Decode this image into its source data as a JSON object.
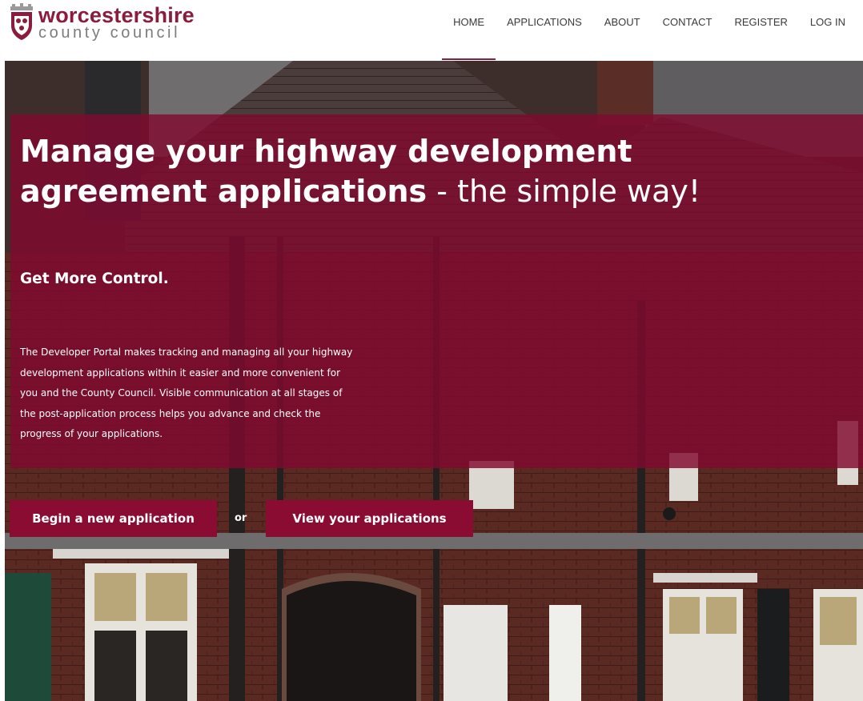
{
  "header": {
    "logo": {
      "name": "worcestershire",
      "subtitle": "county council",
      "crest_icon": "council-crest-icon"
    },
    "nav": [
      {
        "label": "HOME",
        "active": true
      },
      {
        "label": "APPLICATIONS",
        "active": false
      },
      {
        "label": "ABOUT",
        "active": false
      },
      {
        "label": "CONTACT",
        "active": false
      },
      {
        "label": "REGISTER",
        "active": false
      },
      {
        "label": "LOG IN",
        "active": false
      }
    ]
  },
  "hero": {
    "headline_bold": "Manage your highway development agreement applications",
    "headline_light": " - the simple way!",
    "subheading": "Get More Control.",
    "description": "The Developer Portal makes tracking and managing all your highway development applications within it easier and more convenient for you and the County Council. Visible communication at all stages of the post-application process helps you advance and check the progress of your applications.",
    "actions": {
      "begin_label": "Begin a new application",
      "or_label": "or",
      "view_label": "View your applications"
    }
  },
  "colors": {
    "brand": "#8a1c3d",
    "panel_overlay": "#800a30",
    "button": "#8a0c32",
    "nav_text": "#3b3b3b"
  }
}
